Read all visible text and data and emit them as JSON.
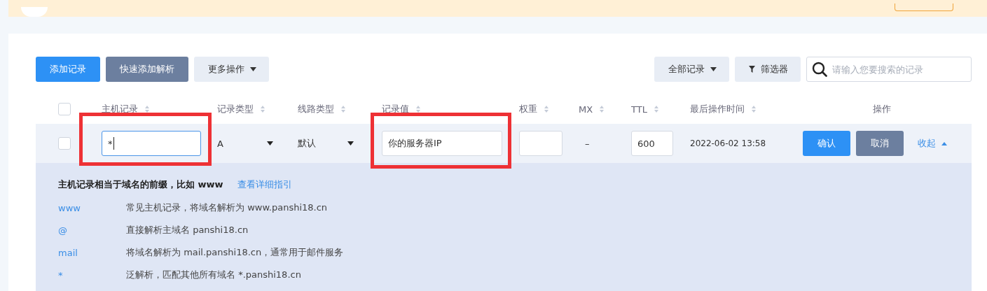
{
  "toolbar": {
    "left_buttons": [
      {
        "label": "添加记录",
        "kind": "primary"
      },
      {
        "label": "快速添加解析",
        "kind": "secondary"
      },
      {
        "label": "更多操作",
        "kind": "dropdown"
      }
    ],
    "right_buttons": [
      {
        "label": "全部记录",
        "kind": "dropdown"
      },
      {
        "label": "筛选器",
        "kind": "filter"
      }
    ],
    "search": {
      "placeholder": "请输入您要搜索的记录"
    }
  },
  "table": {
    "select_all": {
      "checked": false
    },
    "columns": [
      {
        "label": "主机记录",
        "sortable": true
      },
      {
        "label": "记录类型",
        "sortable": true
      },
      {
        "label": "线路类型",
        "sortable": true
      },
      {
        "label": "记录值",
        "sortable": true
      },
      {
        "label": "权重",
        "sortable": true
      },
      {
        "label": "MX",
        "sortable": true
      },
      {
        "label": "TTL",
        "sortable": true
      },
      {
        "label": "最后操作时间",
        "sortable": true
      },
      {
        "label": "操作",
        "sortable": false
      }
    ],
    "edit_row": {
      "checked": false,
      "host": {
        "value": "*",
        "highlighted": true
      },
      "record_type": "A",
      "line": "默认",
      "value": {
        "value": "你的服务器IP",
        "highlighted": true
      },
      "mx": "–",
      "ttl": "600",
      "time": "2022-06-02 13:58",
      "confirm": "确认",
      "cancel": "取消",
      "collapse": "收起"
    }
  },
  "help": {
    "title": "主机记录相当于域名的前缀，比如 www",
    "link": "查看详细指引",
    "items": [
      {
        "key": "www",
        "desc": "常见主机记录，将域名解析为 www.panshi18.cn"
      },
      {
        "key": "@",
        "desc": "直接解析主域名 panshi18.cn"
      },
      {
        "key": "mail",
        "desc": "将域名解析为 mail.panshi18.cn，通常用于邮件服务"
      },
      {
        "key": "*",
        "desc": "泛解析，匹配其他所有域名 *.panshi18.cn"
      }
    ]
  }
}
